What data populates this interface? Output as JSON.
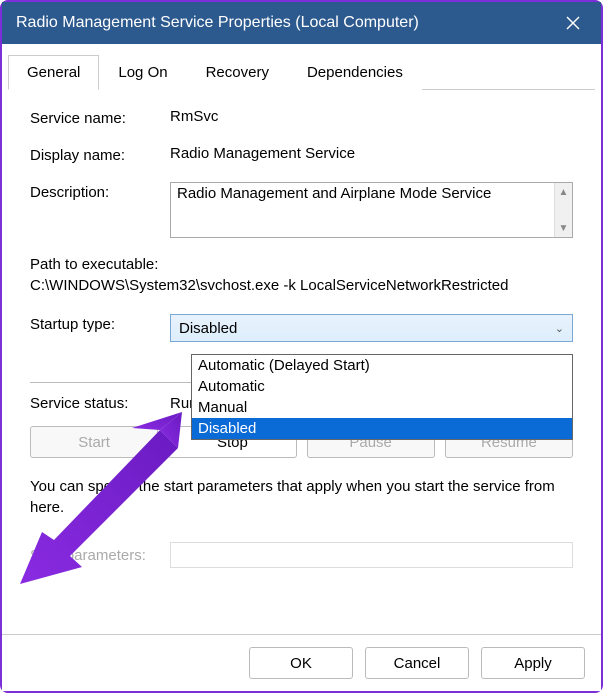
{
  "window": {
    "title": "Radio Management Service Properties (Local Computer)"
  },
  "tabs": {
    "general": "General",
    "logon": "Log On",
    "recovery": "Recovery",
    "dependencies": "Dependencies"
  },
  "labels": {
    "service_name": "Service name:",
    "display_name": "Display name:",
    "description": "Description:",
    "path_label": "Path to executable:",
    "startup_type": "Startup type:",
    "service_status": "Service status:",
    "start_parameters": "Start parameters:"
  },
  "values": {
    "service_name": "RmSvc",
    "display_name": "Radio Management Service",
    "description": "Radio Management and Airplane Mode Service",
    "path": "C:\\WINDOWS\\System32\\svchost.exe -k LocalServiceNetworkRestricted",
    "startup_selected": "Disabled",
    "service_status": "Running",
    "start_parameters": ""
  },
  "startup_options": {
    "auto_delayed": "Automatic (Delayed Start)",
    "auto": "Automatic",
    "manual": "Manual",
    "disabled": "Disabled"
  },
  "buttons": {
    "start": "Start",
    "stop": "Stop",
    "pause": "Pause",
    "resume": "Resume",
    "ok": "OK",
    "cancel": "Cancel",
    "apply": "Apply"
  },
  "note": "You can specify the start parameters that apply when you start the service from here."
}
